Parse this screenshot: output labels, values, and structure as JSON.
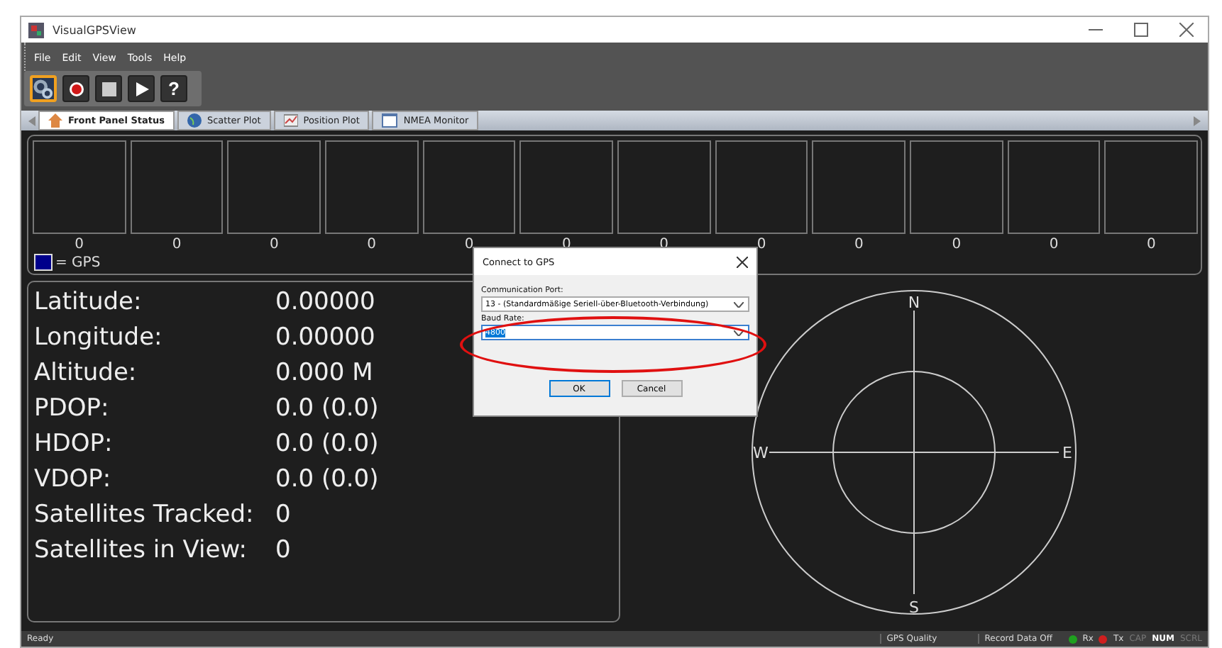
{
  "window": {
    "title": "VisualGPSView"
  },
  "menu": [
    "File",
    "Edit",
    "View",
    "Tools",
    "Help"
  ],
  "toolbar": [
    {
      "kind": "settings",
      "selected": true
    },
    {
      "kind": "record",
      "selected": false
    },
    {
      "kind": "stop",
      "selected": false
    },
    {
      "kind": "play",
      "selected": false
    },
    {
      "kind": "help",
      "selected": false,
      "label": "?"
    }
  ],
  "tabs": [
    {
      "label": "Front Panel Status",
      "kind": "home",
      "selected": true
    },
    {
      "label": "Scatter Plot",
      "kind": "globe",
      "selected": false
    },
    {
      "label": "Position Plot",
      "kind": "chart",
      "selected": false
    },
    {
      "label": "NMEA Monitor",
      "kind": "monitor",
      "selected": false
    }
  ],
  "signal_bars": [
    {
      "reading": "0",
      "level": 0
    },
    {
      "reading": "0",
      "level": 0
    },
    {
      "reading": "0",
      "level": 0
    },
    {
      "reading": "0",
      "level": 0
    },
    {
      "reading": "0",
      "level": 0
    },
    {
      "reading": "0",
      "level": 0
    },
    {
      "reading": "0",
      "level": 0
    },
    {
      "reading": "0",
      "level": 0
    },
    {
      "reading": "0",
      "level": 0
    },
    {
      "reading": "0",
      "level": 0
    },
    {
      "reading": "0",
      "level": 0
    },
    {
      "reading": "0",
      "level": 0
    }
  ],
  "legend": {
    "label": "= GPS",
    "color": "#00008b"
  },
  "position": [
    {
      "label": "Latitude:",
      "value": "0.00000"
    },
    {
      "label": "Longitude:",
      "value": "0.00000"
    },
    {
      "label": "Altitude:",
      "value": "0.000 M"
    },
    {
      "label": "PDOP:",
      "value": "0.0 (0.0)"
    },
    {
      "label": "HDOP:",
      "value": "0.0 (0.0)"
    },
    {
      "label": "VDOP:",
      "value": "0.0 (0.0)"
    },
    {
      "label": "Satellites Tracked:",
      "value": "0"
    },
    {
      "label": "Satellites in View:",
      "value": "0"
    }
  ],
  "compass": {
    "north": "N",
    "south": "S",
    "east": "E",
    "west": "W"
  },
  "dialog": {
    "title": "Connect to GPS",
    "port_label": "Communication Port:",
    "port_value": "13 - (Standardmäßige Seriell-über-Bluetooth-Verbindung)",
    "baud_label": "Baud Rate:",
    "baud_value": "4800",
    "baud_value_selected": true,
    "buttons": [
      {
        "label": "OK",
        "default": true
      },
      {
        "label": "Cancel",
        "default": false
      }
    ]
  },
  "status_bar": {
    "ready": "Ready",
    "gps_quality": "GPS Quality",
    "record": "Record Data Off",
    "lights": [
      {
        "label": "Rx",
        "color": "#1fa01f"
      },
      {
        "label": "Tx",
        "color": "#d01f1f"
      }
    ],
    "keys": [
      {
        "label": "CAP",
        "on": false
      },
      {
        "label": "NUM",
        "on": true
      },
      {
        "label": "SCRL",
        "on": false
      }
    ]
  }
}
